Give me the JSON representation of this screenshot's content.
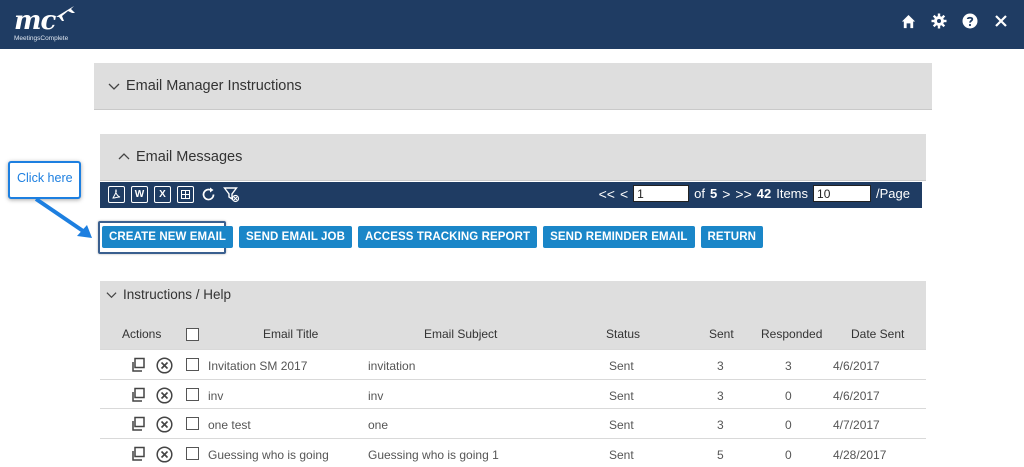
{
  "logo": {
    "mark": "mc",
    "text": "MeetingsComplete"
  },
  "top_icons": [
    "home-icon",
    "gear-icon",
    "help-icon",
    "close-icon"
  ],
  "panels": {
    "instructions": "Email Manager Instructions",
    "messages": "Email Messages",
    "help": "Instructions / Help"
  },
  "toolbar": {
    "icons": [
      "pdf-icon",
      "word-icon",
      "excel-icon",
      "csv-icon",
      "refresh-icon",
      "clear-filter-icon"
    ],
    "icon_labels": {
      "word": "W",
      "excel": "X"
    },
    "pager": {
      "first": "<<",
      "prev": "<",
      "page": "1",
      "of_label": "of",
      "total_pages": "5",
      "next": ">",
      "last": ">>",
      "items_count": "42",
      "items_label": "Items",
      "page_size": "10",
      "per_page_label": "/Page"
    }
  },
  "buttons": {
    "create": "CREATE NEW EMAIL",
    "send_job": "SEND EMAIL JOB",
    "tracking": "ACCESS TRACKING REPORT",
    "reminder": "SEND REMINDER EMAIL",
    "return": "RETURN"
  },
  "callout": {
    "text": "Click here"
  },
  "table": {
    "headers": {
      "actions": "Actions",
      "title": "Email Title",
      "subject": "Email Subject",
      "status": "Status",
      "sent": "Sent",
      "responded": "Responded",
      "date": "Date Sent"
    },
    "rows": [
      {
        "title": "Invitation SM 2017",
        "subject": "invitation",
        "status": "Sent",
        "sent": "3",
        "responded": "3",
        "date": "4/6/2017"
      },
      {
        "title": "inv",
        "subject": "inv",
        "status": "Sent",
        "sent": "3",
        "responded": "0",
        "date": "4/6/2017"
      },
      {
        "title": "one test",
        "subject": "one",
        "status": "Sent",
        "sent": "3",
        "responded": "0",
        "date": "4/7/2017"
      },
      {
        "title": "Guessing who is going",
        "subject": "Guessing who is going 1",
        "status": "Sent",
        "sent": "5",
        "responded": "0",
        "date": "4/28/2017"
      }
    ]
  },
  "colors": {
    "nav": "#1f3c63",
    "button": "#1a86c8",
    "callout": "#1d7fe0",
    "panel": "#dedede"
  }
}
